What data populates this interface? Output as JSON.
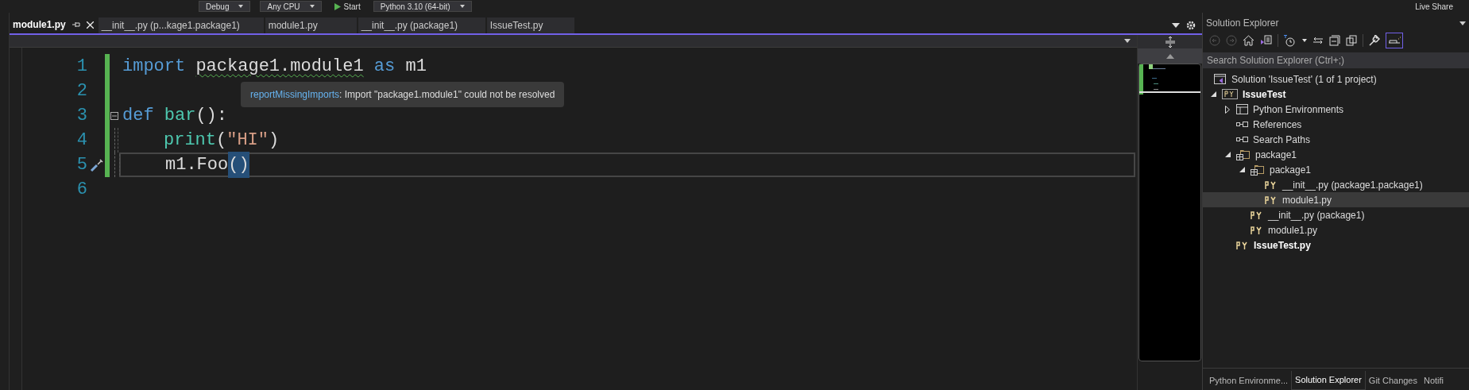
{
  "toolbar": {
    "items": [
      {
        "label": "Debug",
        "kind": "dropdown"
      },
      {
        "label": "Any CPU",
        "kind": "dropdown"
      },
      {
        "label": "Start",
        "kind": "run"
      },
      {
        "label": "Python 3.10 (64-bit)",
        "kind": "dropdown"
      }
    ],
    "live_share": "Live Share"
  },
  "tabs": [
    {
      "label": "module1.py",
      "selected": true
    },
    {
      "label": "__init__.py (p...kage1.package1)",
      "selected": false
    },
    {
      "label": "module1.py",
      "selected": false
    },
    {
      "label": "__init__.py (package1)",
      "selected": false
    },
    {
      "label": "IssueTest.py",
      "selected": false
    }
  ],
  "editor": {
    "lines": [
      {
        "number": "1",
        "current": false,
        "foldable": false,
        "quick_action": false,
        "tokens": [
          {
            "text": "import ",
            "kind": "keyword",
            "error": false,
            "matched": false
          },
          {
            "text": "package1.module1",
            "kind": "plain",
            "error": true,
            "matched": false
          },
          {
            "text": " as ",
            "kind": "keyword",
            "error": false,
            "matched": false
          },
          {
            "text": "m1",
            "kind": "plain",
            "error": false,
            "matched": false
          }
        ]
      },
      {
        "number": "2",
        "current": false,
        "foldable": false,
        "quick_action": false
      },
      {
        "number": "3",
        "current": false,
        "foldable": true,
        "quick_action": false,
        "tokens": [
          {
            "text": "def ",
            "kind": "keyword",
            "error": false,
            "matched": false
          },
          {
            "text": "bar",
            "kind": "function",
            "error": false,
            "matched": false
          },
          {
            "text": "():",
            "kind": "plain",
            "error": false,
            "matched": false
          }
        ],
        "children": [
          {
            "number": "4",
            "current": false,
            "foldable": false,
            "quick_action": false,
            "tokens": [
              {
                "text": "print",
                "kind": "function",
                "error": false,
                "matched": false
              },
              {
                "text": "(",
                "kind": "plain",
                "error": false,
                "matched": false
              },
              {
                "text": "\"HI\"",
                "kind": "string",
                "error": false,
                "matched": false
              },
              {
                "text": ")",
                "kind": "plain",
                "error": false,
                "matched": false
              }
            ]
          },
          {
            "number": "5",
            "current": true,
            "foldable": false,
            "quick_action": true,
            "tokens": [
              {
                "text": "m1.Foo",
                "kind": "plain",
                "error": false,
                "matched": false
              },
              {
                "text": "()",
                "kind": "plain",
                "error": false,
                "matched": true
              }
            ]
          }
        ]
      },
      {
        "number": "6",
        "current": false,
        "foldable": false,
        "quick_action": false
      }
    ],
    "tooltip": {
      "code": "reportMissingImports",
      "message": ": Import \"package1.module1\" could not be resolved"
    }
  },
  "solution_explorer": {
    "title": "Solution Explorer",
    "search": {
      "placeholder": "Search Solution Explorer (Ctrl+;)"
    },
    "tree": [
      {
        "label": "Solution 'IssueTest' (1 of 1 project)",
        "kind": "solution",
        "bold": false,
        "selected": false,
        "children": [
          {
            "label": "IssueTest",
            "kind": "project",
            "bold": true,
            "selected": false,
            "expanded": true,
            "children": [
              {
                "label": "Python Environments",
                "kind": "environments",
                "bold": false,
                "selected": false,
                "expanded": false
              },
              {
                "label": "References",
                "kind": "references",
                "bold": false,
                "selected": false
              },
              {
                "label": "Search Paths",
                "kind": "references",
                "bold": false,
                "selected": false
              },
              {
                "label": "package1",
                "kind": "package",
                "bold": false,
                "selected": false,
                "expanded": true,
                "children": [
                  {
                    "label": "package1",
                    "kind": "package",
                    "bold": false,
                    "selected": false,
                    "expanded": true,
                    "children": [
                      {
                        "label": "__init__.py (package1.package1)",
                        "kind": "file",
                        "bold": false,
                        "selected": false
                      },
                      {
                        "label": "module1.py",
                        "kind": "file",
                        "bold": false,
                        "selected": true
                      }
                    ]
                  },
                  {
                    "label": "__init__.py (package1)",
                    "kind": "file",
                    "bold": false,
                    "selected": false
                  },
                  {
                    "label": "module1.py",
                    "kind": "file",
                    "bold": false,
                    "selected": false
                  }
                ]
              },
              {
                "label": "IssueTest.py",
                "kind": "file",
                "bold": true,
                "selected": false
              }
            ]
          }
        ]
      }
    ],
    "bottom_tabs": [
      {
        "label": "Python Environme...",
        "selected": false
      },
      {
        "label": "Solution Explorer",
        "selected": true
      },
      {
        "label": "Git Changes",
        "selected": false
      },
      {
        "label": "Notifi",
        "selected": false
      }
    ]
  }
}
